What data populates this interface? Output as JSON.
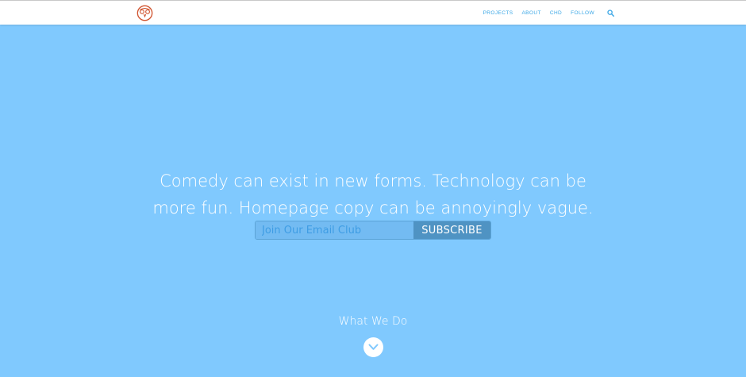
{
  "colors": {
    "background": "#80c9fe",
    "nav_link": "#3ba7e6",
    "logo": "#d0532e",
    "subscribe_button": "#4f93c3",
    "email_input": "#73bbf2"
  },
  "header": {
    "logo_icon": "owl-logo-icon",
    "nav": {
      "items": [
        {
          "label": "PROJECTS"
        },
        {
          "label": "ABOUT"
        },
        {
          "label": "CHD"
        },
        {
          "label": "FOLLOW"
        }
      ],
      "search_icon": "search-icon"
    }
  },
  "hero": {
    "headline_line1": "Comedy can exist in new forms. Technology can be",
    "headline_line2": "more fun. Homepage copy can be annoyingly vague.",
    "signup": {
      "email_placeholder": "Join Our Email Club",
      "email_value": "",
      "subscribe_label": "SUBSCRIBE"
    },
    "what_we_do_label": "What We Do",
    "scroll_icon": "chevron-down-icon"
  }
}
